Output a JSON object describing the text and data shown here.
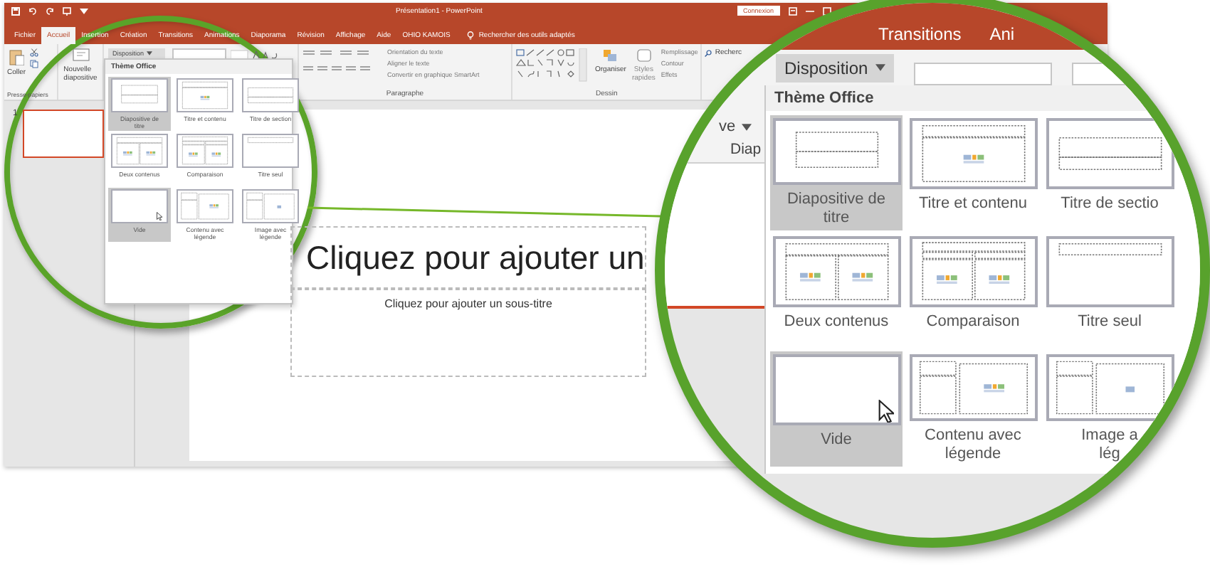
{
  "title_bar": {
    "title": "Présentation1 - PowerPoint",
    "sign_in": "Connexion"
  },
  "tabs": [
    {
      "label": "Fichier",
      "selected": false
    },
    {
      "label": "Accueil",
      "selected": true
    },
    {
      "label": "Insertion",
      "selected": false
    },
    {
      "label": "Création",
      "selected": false
    },
    {
      "label": "Transitions",
      "selected": false
    },
    {
      "label": "Animations",
      "selected": false
    },
    {
      "label": "Diaporama",
      "selected": false
    },
    {
      "label": "Révision",
      "selected": false
    },
    {
      "label": "Affichage",
      "selected": false
    },
    {
      "label": "Aide",
      "selected": false
    },
    {
      "label": "OHIO KAMOIS",
      "selected": false
    }
  ],
  "tell_me": "Rechercher des outils adaptés",
  "ribbon": {
    "paste": "Coller",
    "clipboard_group": "Presse-papiers",
    "new_slide": [
      "Nouvelle",
      "diapositive"
    ],
    "layout_button": "Disposition",
    "paragraph_items": [
      "Orientation du texte",
      "Aligner le texte",
      "Convertir en graphique SmartArt"
    ],
    "paragraph_group": "Paragraphe",
    "arrange": "Organiser",
    "quick_styles": [
      "Styles",
      "rapides"
    ],
    "drawing_items": [
      "Remplissage",
      "Contour",
      "Effets"
    ],
    "drawing_group": "Dessin",
    "find": "Recherc"
  },
  "layout_gallery": {
    "heading": "Thème Office",
    "layouts": [
      {
        "kind": "title",
        "label": [
          "Diapositive de",
          "titre"
        ],
        "highlighted": true,
        "pointer": false
      },
      {
        "kind": "title-content",
        "label": [
          "Titre et contenu"
        ],
        "highlighted": false,
        "pointer": false
      },
      {
        "kind": "section",
        "label": [
          "Titre de section"
        ],
        "highlighted": false,
        "pointer": false
      },
      {
        "kind": "two-content",
        "label": [
          "Deux contenus"
        ],
        "highlighted": false,
        "pointer": false
      },
      {
        "kind": "comparison",
        "label": [
          "Comparaison"
        ],
        "highlighted": false,
        "pointer": false
      },
      {
        "kind": "title-only",
        "label": [
          "Titre seul"
        ],
        "highlighted": false,
        "pointer": false
      },
      {
        "kind": "blank",
        "label": [
          "Vide"
        ],
        "highlighted": true,
        "pointer": true
      },
      {
        "kind": "content-caption",
        "label": [
          "Contenu avec",
          "légende"
        ],
        "highlighted": false,
        "pointer": false
      },
      {
        "kind": "picture-caption",
        "label": [
          "Image avec",
          "légende"
        ],
        "highlighted": false,
        "pointer": false
      }
    ]
  },
  "slide_pane": {
    "slides": [
      {
        "number": "1",
        "selected": true
      }
    ]
  },
  "slide": {
    "title": "Cliquez pour ajouter un",
    "subtitle": "Cliquez pour ajouter un sous-titre"
  },
  "magnifier": {
    "tabs": [
      "Transitions",
      "Ani"
    ],
    "new_slide_tail": "ve",
    "slides_group": "Diap",
    "layout_button": "Disposition",
    "heading": "Thème Office",
    "layouts": [
      {
        "kind": "title",
        "label": [
          "Diapositive de",
          "titre"
        ],
        "highlighted": true,
        "pointer": false
      },
      {
        "kind": "title-content",
        "label": [
          "Titre et contenu"
        ],
        "highlighted": false,
        "pointer": false
      },
      {
        "kind": "section",
        "label": [
          "Titre de sectio"
        ],
        "highlighted": false,
        "pointer": false
      },
      {
        "kind": "two-content",
        "label": [
          "Deux contenus"
        ],
        "highlighted": false,
        "pointer": false
      },
      {
        "kind": "comparison",
        "label": [
          "Comparaison"
        ],
        "highlighted": false,
        "pointer": false
      },
      {
        "kind": "title-only",
        "label": [
          "Titre seul"
        ],
        "highlighted": false,
        "pointer": false
      },
      {
        "kind": "blank",
        "label": [
          "Vide"
        ],
        "highlighted": true,
        "pointer": true
      },
      {
        "kind": "content-caption",
        "label": [
          "Contenu avec",
          "légende"
        ],
        "highlighted": false,
        "pointer": false
      },
      {
        "kind": "picture-caption",
        "label": [
          "Image a",
          "lég"
        ],
        "highlighted": false,
        "pointer": false
      }
    ]
  }
}
